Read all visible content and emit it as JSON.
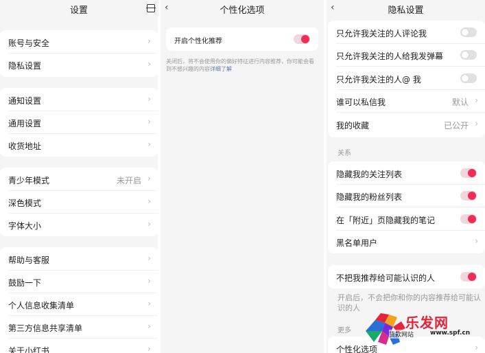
{
  "settings": {
    "title": "设置",
    "items": [
      {
        "label": "账号与安全"
      },
      {
        "label": "隐私设置"
      },
      {
        "label": "通知设置"
      },
      {
        "label": "通用设置"
      },
      {
        "label": "收货地址"
      },
      {
        "label": "青少年模式",
        "value": "未开启"
      },
      {
        "label": "深色模式"
      },
      {
        "label": "字体大小"
      },
      {
        "label": "帮助与客服"
      },
      {
        "label": "鼓励一下"
      },
      {
        "label": "个人信息收集清单"
      },
      {
        "label": "第三方信息共享清单"
      },
      {
        "label": "关于小红书"
      }
    ]
  },
  "personalization": {
    "title": "个性化选项",
    "toggle_label": "开启个性化推荐",
    "toggle_on": true,
    "note": "关闭后，将不会使用你的偏好特征进行内容推荐，你可能会看到不感兴趣的内容",
    "note_link": "详细了解"
  },
  "privacy": {
    "title": "隐私设置",
    "items": [
      {
        "label": "只允许我关注的人评论我",
        "toggle_on": false
      },
      {
        "label": "只允许我关注的人给我发弹幕",
        "toggle_on": false
      },
      {
        "label": "只允许我关注的人@ 我",
        "toggle_on": false
      },
      {
        "label": "谁可以私信我",
        "value": "默认"
      },
      {
        "label": "我的收藏",
        "value": "已公开"
      }
    ],
    "relation_header": "关系",
    "relation_items": [
      {
        "label": "隐藏我的关注列表",
        "toggle_on": true
      },
      {
        "label": "隐藏我的粉丝列表",
        "toggle_on": true
      },
      {
        "label": "在「附近」页隐藏我的笔记",
        "toggle_on": true
      },
      {
        "label": "黑名单用户"
      }
    ],
    "recommend_label": "不把我推荐给可能认识的人",
    "recommend_on": true,
    "recommend_note": "开启后，不会把你和你的内容推荐给可能认识的人",
    "more_header": "更多",
    "more_items": [
      {
        "label": "个性化选项"
      }
    ]
  },
  "watermark": {
    "logo": "乐发网",
    "sub": "货款网站",
    "url": "www.spf.cn"
  },
  "colors": {
    "accent": "#ef2d55",
    "background": "#f5f5f5",
    "card": "#ffffff"
  }
}
